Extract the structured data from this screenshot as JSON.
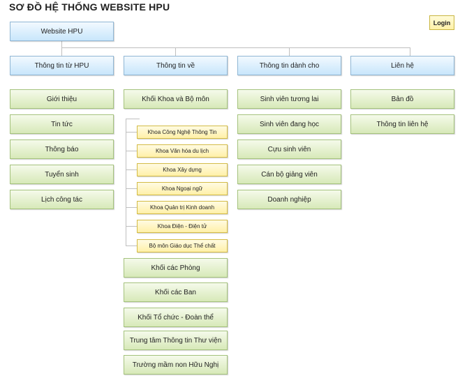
{
  "page": {
    "title": "SƠ ĐỒ HỆ THỐNG WEBSITE HPU",
    "login_label": "Login"
  },
  "root": {
    "label": "Website HPU"
  },
  "columns": [
    {
      "label": "Thông tin từ HPU",
      "items": [
        "Giới thiệu",
        "Tin tức",
        "Thông báo",
        "Tuyển sinh",
        "Lịch công tác"
      ]
    },
    {
      "label": "Thông tin về",
      "group": {
        "label": "Khối Khoa và Bộ môn",
        "items": [
          "Khoa Công Nghệ Thông Tin",
          "Khoa Văn hóa du lịch",
          "Khoa Xây dựng",
          "Khoa Ngoại ngữ",
          "Khoa Quản trị Kinh doanh",
          "Khoa Điện - Điện tử",
          "Bộ môn Giáo dục Thể chất"
        ]
      },
      "items": [
        "Khối các Phòng",
        "Khối các Ban",
        "Khối Tổ chức - Đoàn thể",
        "Trung tâm Thông tin Thư viện",
        "Trường mầm non Hữu Nghị"
      ]
    },
    {
      "label": "Thông tin dành cho",
      "items": [
        "Sinh viên tương lai",
        "Sinh viên đang học",
        "Cựu sinh viên",
        "Cán bộ giảng viên",
        "Doanh nghiệp"
      ]
    },
    {
      "label": "Liên hệ",
      "items": [
        "Bản đồ",
        "Thông tin liên hệ"
      ]
    }
  ]
}
